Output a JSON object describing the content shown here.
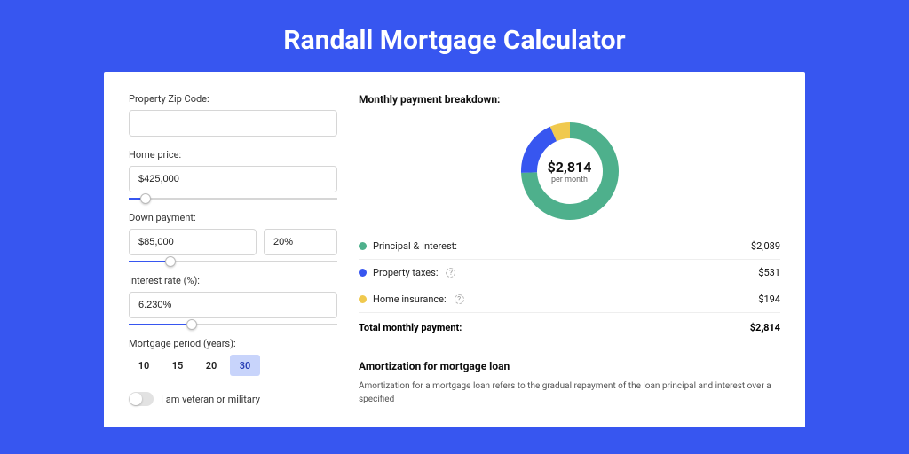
{
  "title": "Randall Mortgage Calculator",
  "form": {
    "zip_label": "Property Zip Code:",
    "zip_value": "",
    "home_price_label": "Home price:",
    "home_price_value": "$425,000",
    "home_price_slider_pct": 8,
    "down_label": "Down payment:",
    "down_value": "$85,000",
    "down_pct_value": "20%",
    "down_slider_pct": 20,
    "rate_label": "Interest rate (%):",
    "rate_value": "6.230%",
    "rate_slider_pct": 30,
    "period_label": "Mortgage period (years):",
    "periods": [
      "10",
      "15",
      "20",
      "30"
    ],
    "period_selected": "30",
    "veteran_label": "I am veteran or military"
  },
  "breakdown": {
    "title": "Monthly payment breakdown:",
    "center_amount": "$2,814",
    "center_sub": "per month",
    "items": [
      {
        "label": "Principal & Interest:",
        "value": "$2,089",
        "color": "#4eb08c",
        "info": false
      },
      {
        "label": "Property taxes:",
        "value": "$531",
        "color": "#3756f0",
        "info": true
      },
      {
        "label": "Home insurance:",
        "value": "$194",
        "color": "#f0c94e",
        "info": true
      }
    ],
    "total_label": "Total monthly payment:",
    "total_value": "$2,814"
  },
  "chart_data": {
    "type": "pie",
    "title": "Monthly payment breakdown",
    "categories": [
      "Principal & Interest",
      "Property taxes",
      "Home insurance"
    ],
    "values": [
      2089,
      531,
      194
    ],
    "colors": [
      "#4eb08c",
      "#3756f0",
      "#f0c94e"
    ],
    "total": 2814
  },
  "amort": {
    "title": "Amortization for mortgage loan",
    "text": "Amortization for a mortgage loan refers to the gradual repayment of the loan principal and interest over a specified"
  }
}
